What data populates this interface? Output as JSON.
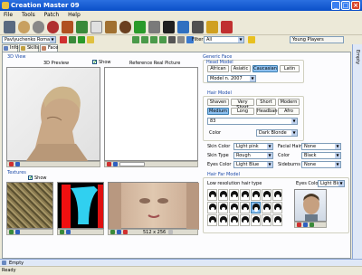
{
  "window": {
    "title": "Creation Master 09",
    "min": "_",
    "max": "□",
    "close": "×"
  },
  "menu": [
    "File",
    "Tools",
    "Patch",
    "Help"
  ],
  "namebar": {
    "player_name": "Pavlyuchenko Roman",
    "filter_label": "Filter",
    "filter_value": "All",
    "team_value": "Young Players"
  },
  "tabs": [
    {
      "label": "Info"
    },
    {
      "label": "Skills"
    },
    {
      "label": "Face"
    }
  ],
  "view3d": {
    "section": "3D View",
    "preview_label": "3D Preview",
    "show_label": "Show",
    "reference_label": "Reference Real Picture"
  },
  "textures": {
    "section": "Textures",
    "show_label": "Show",
    "size_value": "512 x 256"
  },
  "generic_face": {
    "section": "Generic Face",
    "head_model_label": "Head Model",
    "ethnicities": [
      "African",
      "Asiatic",
      "Caucasian",
      "Latin"
    ],
    "selected_ethnicity": "Caucasian",
    "model_value": "Model n. 2007"
  },
  "hair_model": {
    "section": "Hair Model",
    "row1": [
      "Shaven",
      "Very Short",
      "Short",
      "Modern"
    ],
    "row2": [
      "Medium",
      "Long",
      "Headband",
      "Afro"
    ],
    "selected": "Medium",
    "model_value": "83",
    "color_label": "Color",
    "color_value": "Dark Blonde"
  },
  "attributes": {
    "skin_color_label": "Skin Color",
    "skin_color_value": "Light pink",
    "skin_type_label": "Skin Type",
    "skin_type_value": "Rough",
    "eyes_color_label": "Eyes Color",
    "eyes_color_value": "Light Blue",
    "facial_hair_label": "Facial Hair",
    "facial_hair_value": "None",
    "fh_color_label": "Color",
    "fh_color_value": "Black",
    "sideburns_label": "Sideburns",
    "sideburns_value": "None"
  },
  "hair_far": {
    "section": "Hair Far Model",
    "low_res_label": "Low resolution hair type",
    "eyes_color_label": "Eyes Color",
    "eyes_color_value": "Light Blue"
  },
  "side_panel": {
    "label": "Empty"
  },
  "bottom_panel": {
    "label": "Empty"
  },
  "status": "Ready",
  "colors": {
    "title_blue": "#0a4fc8",
    "selection_blue": "#8dc0f0",
    "group_header_blue": "#1c4aa8",
    "panel_bg": "#ece9d8"
  }
}
